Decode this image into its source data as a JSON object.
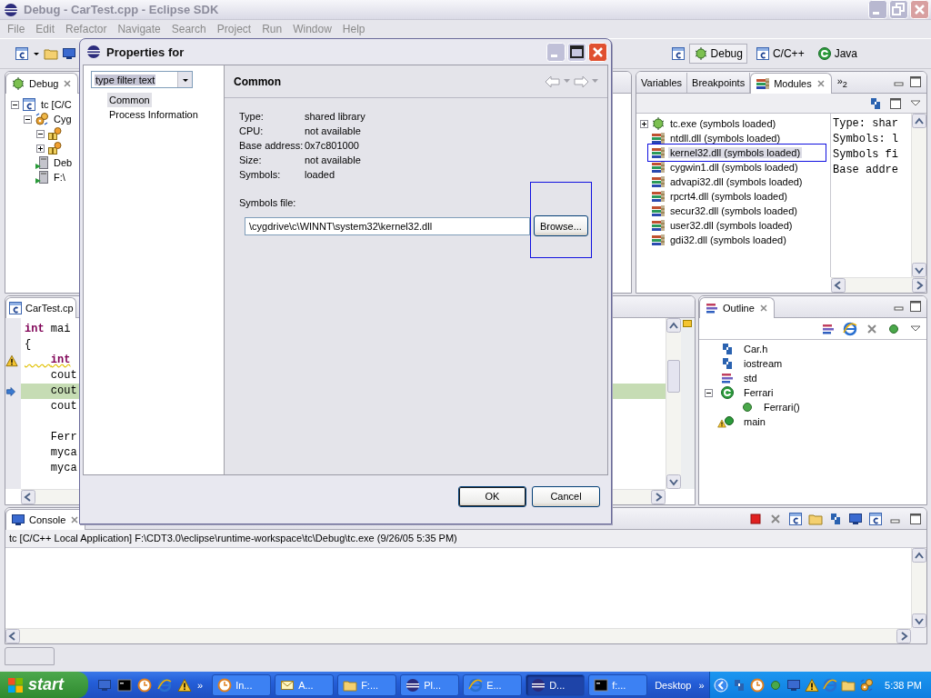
{
  "window": {
    "title": "Debug - CarTest.cpp - Eclipse SDK"
  },
  "menu": [
    "File",
    "Edit",
    "Refactor",
    "Navigate",
    "Search",
    "Project",
    "Run",
    "Window",
    "Help"
  ],
  "perspectives": [
    {
      "label": "Debug",
      "selected": true
    },
    {
      "label": "C/C++",
      "selected": false
    },
    {
      "label": "Java",
      "selected": false
    }
  ],
  "debug_view": {
    "tab": "Debug",
    "tree": [
      {
        "kind": "launch",
        "label": "tc [C/C",
        "expanded": true,
        "children": [
          {
            "kind": "target",
            "label": "Cyg",
            "expanded": true,
            "children": [
              {
                "kind": "thread",
                "expanded": true
              },
              {
                "kind": "thread",
                "expanded": false
              }
            ]
          },
          {
            "kind": "process",
            "label": "Deb"
          },
          {
            "kind": "process",
            "label": "F:\\"
          }
        ]
      }
    ]
  },
  "editor": {
    "tab": "CarTest.cp",
    "lines": [
      {
        "kind": "code",
        "code": "**int** mai",
        "warning": false,
        "current": false
      },
      {
        "kind": "code",
        "code": "{",
        "warning": false,
        "current": false
      },
      {
        "kind": "code",
        "code": "    **int**",
        "warning": true,
        "current": false
      },
      {
        "kind": "code",
        "code": "    cout",
        "warning": false,
        "current": false
      },
      {
        "kind": "code",
        "code": "    cout",
        "warning": false,
        "current": true
      },
      {
        "kind": "code",
        "code": "    cout",
        "warning": false,
        "current": false
      },
      {
        "kind": "blank"
      },
      {
        "kind": "code",
        "code": "    Ferr",
        "warning": false,
        "current": false
      },
      {
        "kind": "code",
        "code": "    myca",
        "warning": false,
        "current": false
      },
      {
        "kind": "code",
        "code": "    myca",
        "warning": false,
        "current": false
      }
    ]
  },
  "modules_view": {
    "tabs": [
      {
        "label": "Variables",
        "selected": false
      },
      {
        "label": "Breakpoints",
        "selected": false
      },
      {
        "label": "Modules",
        "selected": true
      }
    ],
    "overflow": "»$_{2}$",
    "modules": [
      {
        "kind": "executable",
        "label": "tc.exe (symbols loaded)",
        "expanded": false,
        "selected": false,
        "highlighted": false
      },
      {
        "kind": "library",
        "label": "ntdll.dll (symbols loaded)",
        "selected": false,
        "highlighted": false
      },
      {
        "kind": "library",
        "label": "kernel32.dll (symbols loaded)",
        "selected": true,
        "highlighted": true
      },
      {
        "kind": "library",
        "label": "cygwin1.dll (symbols loaded)",
        "selected": false,
        "highlighted": false
      },
      {
        "kind": "library",
        "label": "advapi32.dll (symbols loaded)",
        "selected": false,
        "highlighted": false
      },
      {
        "kind": "library",
        "label": "rpcrt4.dll (symbols loaded)",
        "selected": false,
        "highlighted": false
      },
      {
        "kind": "library",
        "label": "secur32.dll (symbols loaded)",
        "selected": false,
        "highlighted": false
      },
      {
        "kind": "library",
        "label": "user32.dll (symbols loaded)",
        "selected": false,
        "highlighted": false
      },
      {
        "kind": "library",
        "label": "gdi32.dll (symbols loaded)",
        "selected": false,
        "highlighted": false
      }
    ],
    "details": [
      "Type: shar",
      "Symbols: l",
      "Symbols fi",
      "Base addre"
    ]
  },
  "outline": {
    "tab": "Outline",
    "items": [
      {
        "kind": "include",
        "label": "Car.h",
        "warning": false
      },
      {
        "kind": "include",
        "label": "iostream",
        "warning": false
      },
      {
        "kind": "namespace",
        "label": "std",
        "warning": false
      },
      {
        "kind": "class",
        "label": "Ferrari",
        "warning": false,
        "expanded": true,
        "children": [
          {
            "kind": "method",
            "label": "Ferrari()",
            "warning": false
          }
        ]
      },
      {
        "kind": "function",
        "label": "main",
        "warning": true
      }
    ]
  },
  "console": {
    "tab": "Console",
    "process": "tc [C/C++ Local Application] F:\\CDT3.0\\eclipse\\runtime-workspace\\tc\\Debug\\tc.exe (9/26/05 5:35 PM)"
  },
  "dialog": {
    "title": "Properties for",
    "filter": {
      "value": "type filter text",
      "text_selected": true
    },
    "pages": [
      {
        "label": "Common",
        "selected": true
      },
      {
        "label": "Process Information",
        "selected": false
      }
    ],
    "heading": "Common",
    "properties": [
      {
        "label": "Type:",
        "value": "shared library"
      },
      {
        "label": "CPU:",
        "value": "not available"
      },
      {
        "label": "Base address:",
        "value": "0x7c801000"
      },
      {
        "label": "Size:",
        "value": "not available"
      },
      {
        "label": "Symbols:",
        "value": "loaded"
      }
    ],
    "symbols_file": {
      "label": "Symbols file:",
      "value": "\\cygdrive\\c\\WINNT\\system32\\kernel32.dll"
    },
    "browse_button": {
      "label": "Browse...",
      "highlighted": true
    },
    "buttons": [
      {
        "label": "OK",
        "default": true
      },
      {
        "label": "Cancel",
        "default": false
      }
    ]
  },
  "taskbar": {
    "start": "start",
    "quick_launch_more": "»",
    "tasks": [
      {
        "label": "In...",
        "kind": "clock",
        "selected": false
      },
      {
        "label": "A...",
        "kind": "mail",
        "selected": false
      },
      {
        "label": "F:...",
        "kind": "folder",
        "selected": false
      },
      {
        "label": "Pl...",
        "kind": "eclipse",
        "selected": false
      },
      {
        "label": "E...",
        "kind": "browser",
        "selected": false
      },
      {
        "label": "D...",
        "kind": "eclipse",
        "selected": true
      },
      {
        "label": "f:...",
        "kind": "console",
        "selected": false
      }
    ],
    "desktop": "Desktop",
    "tasks_more": "»",
    "clock": "5:38 PM"
  }
}
